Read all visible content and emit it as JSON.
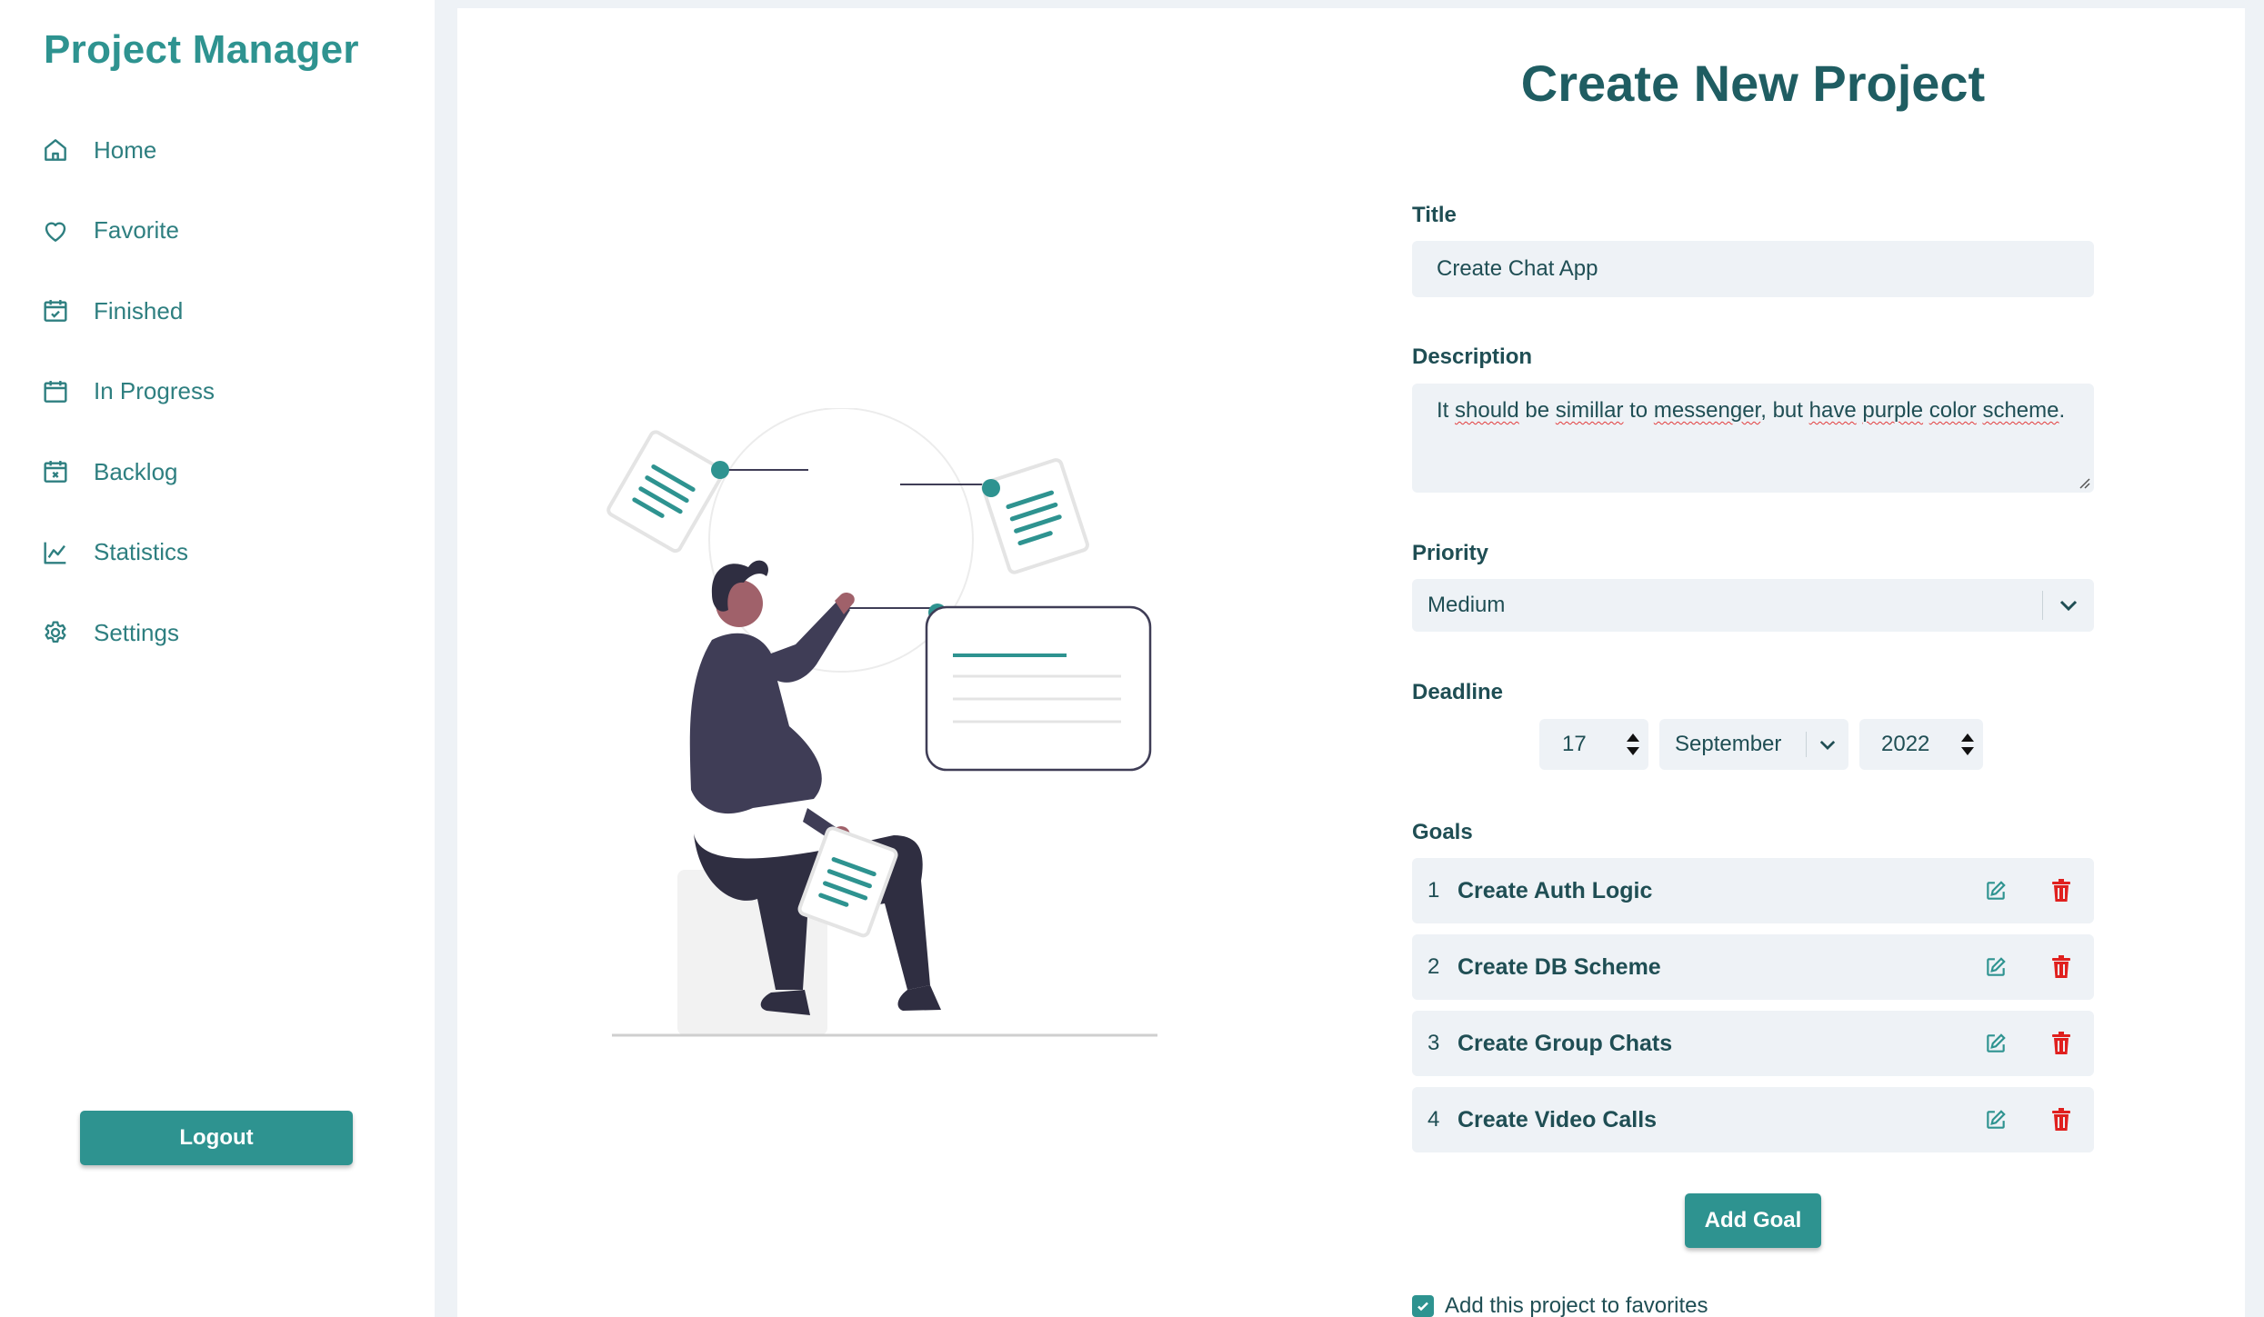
{
  "app": {
    "brand": "Project Manager"
  },
  "sidebar": {
    "items": [
      {
        "label": "Home",
        "icon": "home-icon"
      },
      {
        "label": "Favorite",
        "icon": "heart-icon"
      },
      {
        "label": "Finished",
        "icon": "calendar-check-icon"
      },
      {
        "label": "In Progress",
        "icon": "calendar-icon"
      },
      {
        "label": "Backlog",
        "icon": "calendar-x-icon"
      },
      {
        "label": "Statistics",
        "icon": "chart-line-icon"
      },
      {
        "label": "Settings",
        "icon": "gear-icon"
      }
    ],
    "logout_label": "Logout"
  },
  "form": {
    "title": "Create New Project",
    "title_label": "Title",
    "title_value": "Create Chat App",
    "description_label": "Description",
    "description_value": "It should be simillar to messenger, but have purple color scheme.",
    "priority_label": "Priority",
    "priority_value": "Medium",
    "deadline_label": "Deadline",
    "deadline": {
      "day": "17",
      "month": "September",
      "year": "2022"
    },
    "goals_label": "Goals",
    "goals": [
      {
        "num": "1",
        "text": "Create Auth Logic"
      },
      {
        "num": "2",
        "text": "Create DB Scheme"
      },
      {
        "num": "3",
        "text": "Create Group Chats"
      },
      {
        "num": "4",
        "text": "Create Video Calls"
      }
    ],
    "add_goal_label": "Add Goal",
    "favorite_label": "Add this project to favorites",
    "favorite_checked": true
  },
  "colors": {
    "accent": "#2e9390",
    "text": "#1f4e54",
    "field_bg": "#eef2f6",
    "delete": "#e0201e",
    "figure_dark": "#3f3d56",
    "skin": "#a0616a"
  }
}
